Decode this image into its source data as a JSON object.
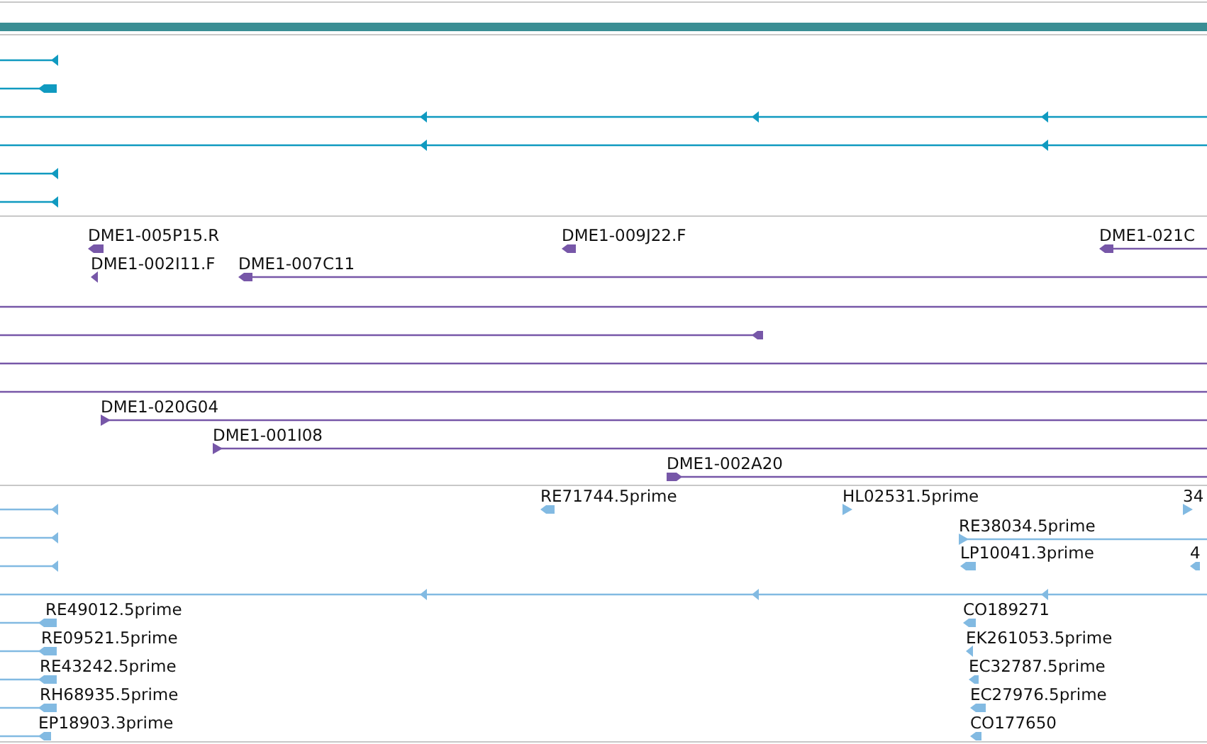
{
  "tracks": [
    {
      "kind": "band",
      "color": "#3a8e94"
    },
    {
      "kind": "features",
      "color": "#109ac0",
      "features": [
        {
          "kind": "reverse"
        },
        {
          "kind": "reverse"
        },
        {
          "kind": "reverse"
        },
        {
          "kind": "reverse"
        },
        {
          "kind": "reverse"
        },
        {
          "kind": "reverse"
        }
      ]
    },
    {
      "kind": "features",
      "color": "#7757a8",
      "features": [
        {
          "label": "DME1-005P15.R",
          "kind": "reverse"
        },
        {
          "label": "DME1-009J22.F",
          "kind": "reverse"
        },
        {
          "label": "DME1-021C",
          "kind": "reverse"
        },
        {
          "label": "DME1-002I11.F",
          "kind": "reverse"
        },
        {
          "label": "DME1-007C11",
          "kind": "reverse"
        },
        {
          "kind": "plain"
        },
        {
          "kind": "reverse"
        },
        {
          "kind": "plain"
        },
        {
          "kind": "plain"
        },
        {
          "label": "DME1-020G04",
          "kind": "forward"
        },
        {
          "label": "DME1-001I08",
          "kind": "forward"
        },
        {
          "label": "DME1-002A20",
          "kind": "forward"
        }
      ]
    },
    {
      "kind": "features",
      "color": "#82bae2",
      "features": [
        {
          "kind": "reverse"
        },
        {
          "label": "RE71744.5prime",
          "kind": "reverse"
        },
        {
          "label": "HL02531.5prime",
          "kind": "forward"
        },
        {
          "label": "34",
          "kind": "forward"
        },
        {
          "kind": "reverse"
        },
        {
          "label": "RE38034.5prime",
          "kind": "forward"
        },
        {
          "kind": "reverse"
        },
        {
          "label": "LP10041.3prime",
          "kind": "reverse"
        },
        {
          "label": "4",
          "kind": "reverse"
        },
        {
          "kind": "reverse"
        },
        {
          "label": "RE49012.5prime",
          "kind": "reverse"
        },
        {
          "label": "CO189271",
          "kind": "reverse"
        },
        {
          "label": "RE09521.5prime",
          "kind": "reverse"
        },
        {
          "label": "EK261053.5prime",
          "kind": "reverse"
        },
        {
          "label": "RE43242.5prime",
          "kind": "reverse"
        },
        {
          "label": "EC32787.5prime",
          "kind": "reverse"
        },
        {
          "label": "RH68935.5prime",
          "kind": "reverse"
        },
        {
          "label": "EC27976.5prime",
          "kind": "reverse"
        },
        {
          "label": "EP18903.3prime",
          "kind": "reverse"
        },
        {
          "label": "CO177650",
          "kind": "reverse"
        }
      ]
    }
  ]
}
